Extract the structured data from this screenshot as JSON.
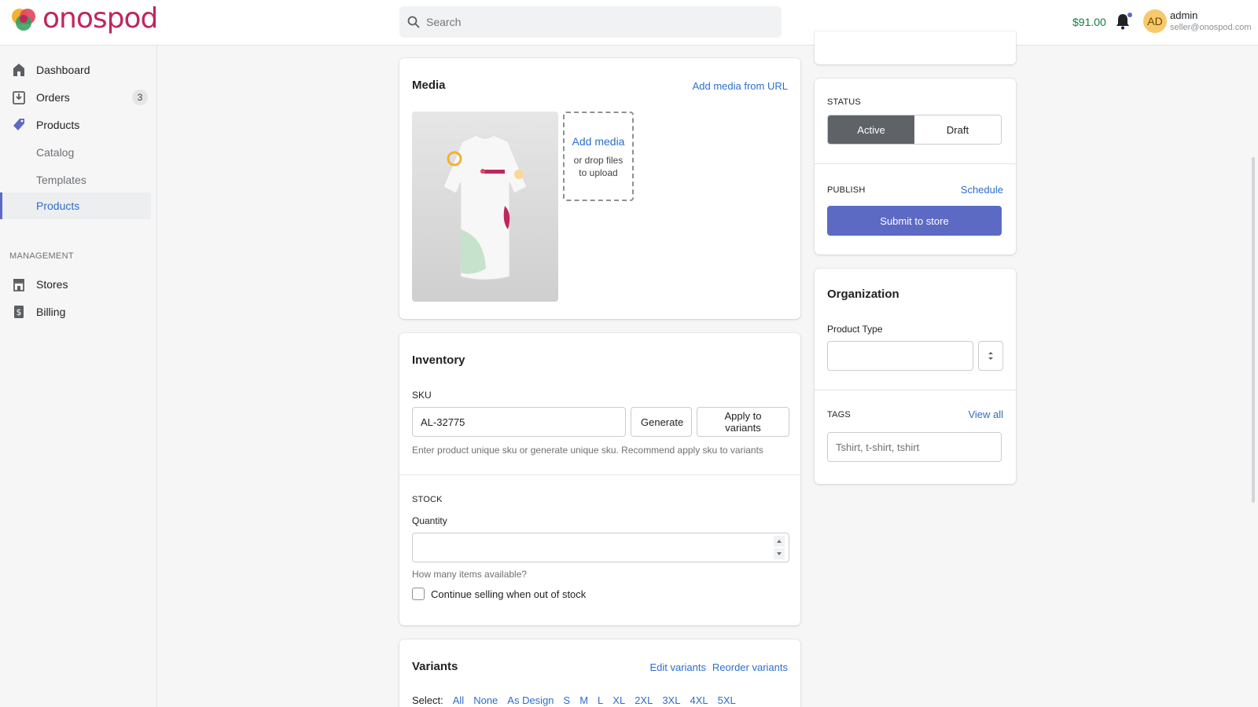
{
  "brand": {
    "name": "onospod"
  },
  "header": {
    "search_placeholder": "Search",
    "balance": "$91.00",
    "avatar_initials": "AD",
    "user_name": "admin",
    "user_email": "seller@onospod.com"
  },
  "sidebar": {
    "items": [
      {
        "label": "Dashboard",
        "icon": "home-icon"
      },
      {
        "label": "Orders",
        "icon": "orders-icon",
        "badge": "3"
      },
      {
        "label": "Products",
        "icon": "tag-icon"
      },
      {
        "label": "Catalog"
      },
      {
        "label": "Templates"
      },
      {
        "label": "Products",
        "active": true
      }
    ],
    "section_heading": "MANAGEMENT",
    "management_items": [
      {
        "label": "Stores",
        "icon": "store-icon"
      },
      {
        "label": "Billing",
        "icon": "billing-icon"
      }
    ]
  },
  "media": {
    "title": "Media",
    "add_from_url": "Add media from URL",
    "add_media": "Add media",
    "drop_hint": "or drop files to upload"
  },
  "inventory": {
    "title": "Inventory",
    "sku_label": "SKU",
    "sku_value": "AL-32775",
    "generate_label": "Generate",
    "apply_label": "Apply to variants",
    "sku_help": "Enter product unique sku or generate unique sku. Recommend apply sku to variants",
    "stock_label": "STOCK",
    "quantity_label": "Quantity",
    "quantity_value": "",
    "quantity_help": "How many items available?",
    "continue_selling_label": "Continue selling when out of stock"
  },
  "variants": {
    "title": "Variants",
    "edit_label": "Edit variants",
    "reorder_label": "Reorder variants",
    "select_label": "Select:",
    "select_options": [
      "All",
      "None",
      "As Design",
      "S",
      "M",
      "L",
      "XL",
      "2XL",
      "3XL",
      "4XL",
      "5XL"
    ]
  },
  "status": {
    "label": "STATUS",
    "active_label": "Active",
    "draft_label": "Draft",
    "selected": "Active"
  },
  "publish": {
    "label": "PUBLISH",
    "schedule_label": "Schedule",
    "submit_label": "Submit to store"
  },
  "organization": {
    "title": "Organization",
    "product_type_label": "Product Type",
    "product_type_value": "",
    "tags_label": "TAGS",
    "view_all_label": "View all",
    "tags_value": "Tshirt, t-shirt, tshirt"
  },
  "colors": {
    "accent": "#5c6ac4",
    "link": "#2c6ecb",
    "brand": "#c0265d",
    "balance": "#108043",
    "active_status_bg": "#5f6368"
  }
}
